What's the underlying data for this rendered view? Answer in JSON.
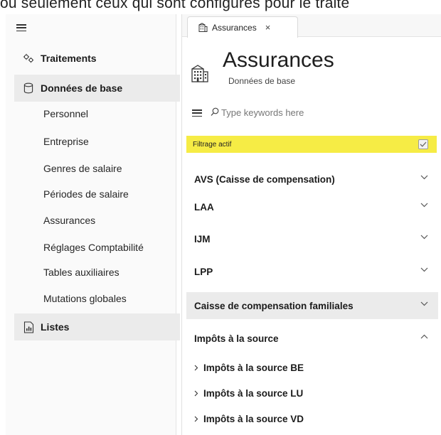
{
  "top_clip": {
    "text": "ou seulement ceux qui sont configurés pour le traite"
  },
  "sidebar": {
    "hamburger_icon": "hamburger-icon",
    "sections": [
      {
        "label": "Traitements",
        "icon": "gears-icon"
      },
      {
        "label": "Données de base",
        "icon": "database-icon",
        "selected": true
      },
      {
        "label": "Listes",
        "icon": "chart-report-icon"
      }
    ],
    "items": [
      "Personnel",
      "Entreprise",
      "Genres de salaire",
      "Périodes de salaire",
      "Assurances",
      "Réglages Comptabilité",
      "Tables auxiliaires",
      "Mutations globales"
    ]
  },
  "tab": {
    "label": "Assurances",
    "close": "×",
    "icon": "building-icon"
  },
  "header": {
    "title": "Assurances",
    "subtitle": "Données de base",
    "icon": "building-icon"
  },
  "search": {
    "placeholder": "Type keywords here"
  },
  "filter": {
    "label": "Filtrage actif",
    "checked": true
  },
  "sections": [
    {
      "label": "AVS (Caisse de compensation)",
      "expanded": false
    },
    {
      "label": "LAA",
      "expanded": false
    },
    {
      "label": "IJM",
      "expanded": false
    },
    {
      "label": "LPP",
      "expanded": false
    },
    {
      "label": "Caisse de compensation familiales",
      "expanded": false,
      "selected": true
    },
    {
      "label": "Impôts à la source",
      "expanded": true
    }
  ],
  "subsections": [
    {
      "label": "Impôts à la source BE"
    },
    {
      "label": "Impôts à la source LU"
    },
    {
      "label": "Impôts à la source VD"
    }
  ],
  "colors": {
    "filter_highlight": "#f6ec45",
    "selected_row": "#ebebeb"
  }
}
